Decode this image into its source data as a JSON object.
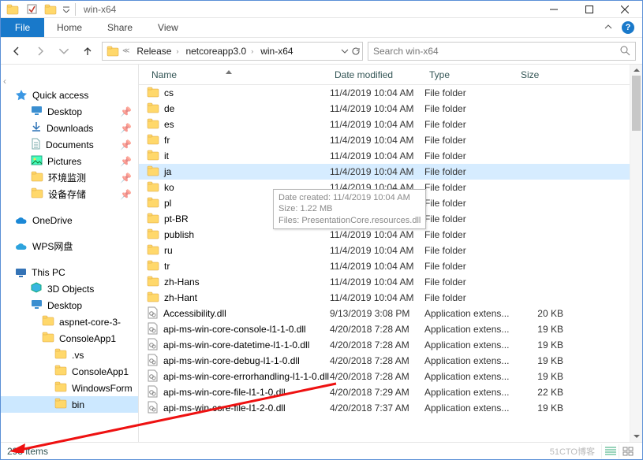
{
  "window": {
    "title": "win-x64"
  },
  "qat": {
    "props_tip": "Properties",
    "new_tip": "New folder"
  },
  "ribbon": {
    "file": "File",
    "tabs": [
      "Home",
      "Share",
      "View"
    ]
  },
  "breadcrumbs": [
    "Release",
    "netcoreapp3.0",
    "win-x64"
  ],
  "search": {
    "placeholder": "Search win-x64"
  },
  "sidebar": {
    "quick": "Quick access",
    "pinned": [
      "Desktop",
      "Downloads",
      "Documents",
      "Pictures",
      "环境监测",
      "设备存储"
    ],
    "onedrive": "OneDrive",
    "wps": "WPS网盘",
    "thispc": "This PC",
    "pcitems": [
      "3D Objects",
      "Desktop"
    ],
    "folders": [
      "aspnet-core-3-",
      "ConsoleApp1",
      ".vs",
      "ConsoleApp1",
      "WindowsForm",
      "bin"
    ]
  },
  "columns": {
    "name": "Name",
    "date": "Date modified",
    "type": "Type",
    "size": "Size"
  },
  "tooltip": {
    "line1": "Date created: 11/4/2019 10:04 AM",
    "line2": "Size: 1.22 MB",
    "line3": "Files: PresentationCore.resources.dll"
  },
  "rows": [
    {
      "name": "cs",
      "date": "11/4/2019 10:04 AM",
      "type": "File folder",
      "size": "",
      "kind": "folder"
    },
    {
      "name": "de",
      "date": "11/4/2019 10:04 AM",
      "type": "File folder",
      "size": "",
      "kind": "folder"
    },
    {
      "name": "es",
      "date": "11/4/2019 10:04 AM",
      "type": "File folder",
      "size": "",
      "kind": "folder"
    },
    {
      "name": "fr",
      "date": "11/4/2019 10:04 AM",
      "type": "File folder",
      "size": "",
      "kind": "folder"
    },
    {
      "name": "it",
      "date": "11/4/2019 10:04 AM",
      "type": "File folder",
      "size": "",
      "kind": "folder"
    },
    {
      "name": "ja",
      "date": "11/4/2019 10:04 AM",
      "type": "File folder",
      "size": "",
      "kind": "folder",
      "selected": true
    },
    {
      "name": "ko",
      "date": "11/4/2019 10:04 AM",
      "type": "File folder",
      "size": "",
      "kind": "folder"
    },
    {
      "name": "pl",
      "date": "11/4/2019 10:04 AM",
      "type": "File folder",
      "size": "",
      "kind": "folder"
    },
    {
      "name": "pt-BR",
      "date": "11/4/2019 10:04 AM",
      "type": "File folder",
      "size": "",
      "kind": "folder"
    },
    {
      "name": "publish",
      "date": "11/4/2019 10:04 AM",
      "type": "File folder",
      "size": "",
      "kind": "folder"
    },
    {
      "name": "ru",
      "date": "11/4/2019 10:04 AM",
      "type": "File folder",
      "size": "",
      "kind": "folder"
    },
    {
      "name": "tr",
      "date": "11/4/2019 10:04 AM",
      "type": "File folder",
      "size": "",
      "kind": "folder"
    },
    {
      "name": "zh-Hans",
      "date": "11/4/2019 10:04 AM",
      "type": "File folder",
      "size": "",
      "kind": "folder"
    },
    {
      "name": "zh-Hant",
      "date": "11/4/2019 10:04 AM",
      "type": "File folder",
      "size": "",
      "kind": "folder"
    },
    {
      "name": "Accessibility.dll",
      "date": "9/13/2019 3:08 PM",
      "type": "Application extens...",
      "size": "20 KB",
      "kind": "dll"
    },
    {
      "name": "api-ms-win-core-console-l1-1-0.dll",
      "date": "4/20/2018 7:28 AM",
      "type": "Application extens...",
      "size": "19 KB",
      "kind": "dll"
    },
    {
      "name": "api-ms-win-core-datetime-l1-1-0.dll",
      "date": "4/20/2018 7:28 AM",
      "type": "Application extens...",
      "size": "19 KB",
      "kind": "dll"
    },
    {
      "name": "api-ms-win-core-debug-l1-1-0.dll",
      "date": "4/20/2018 7:28 AM",
      "type": "Application extens...",
      "size": "19 KB",
      "kind": "dll"
    },
    {
      "name": "api-ms-win-core-errorhandling-l1-1-0.dll",
      "date": "4/20/2018 7:28 AM",
      "type": "Application extens...",
      "size": "19 KB",
      "kind": "dll"
    },
    {
      "name": "api-ms-win-core-file-l1-1-0.dll",
      "date": "4/20/2018 7:29 AM",
      "type": "Application extens...",
      "size": "22 KB",
      "kind": "dll"
    },
    {
      "name": "api-ms-win-core-file-l1-2-0.dll",
      "date": "4/20/2018 7:37 AM",
      "type": "Application extens...",
      "size": "19 KB",
      "kind": "dll"
    }
  ],
  "status": {
    "count": "293 items"
  },
  "watermark": "51CTO博客"
}
